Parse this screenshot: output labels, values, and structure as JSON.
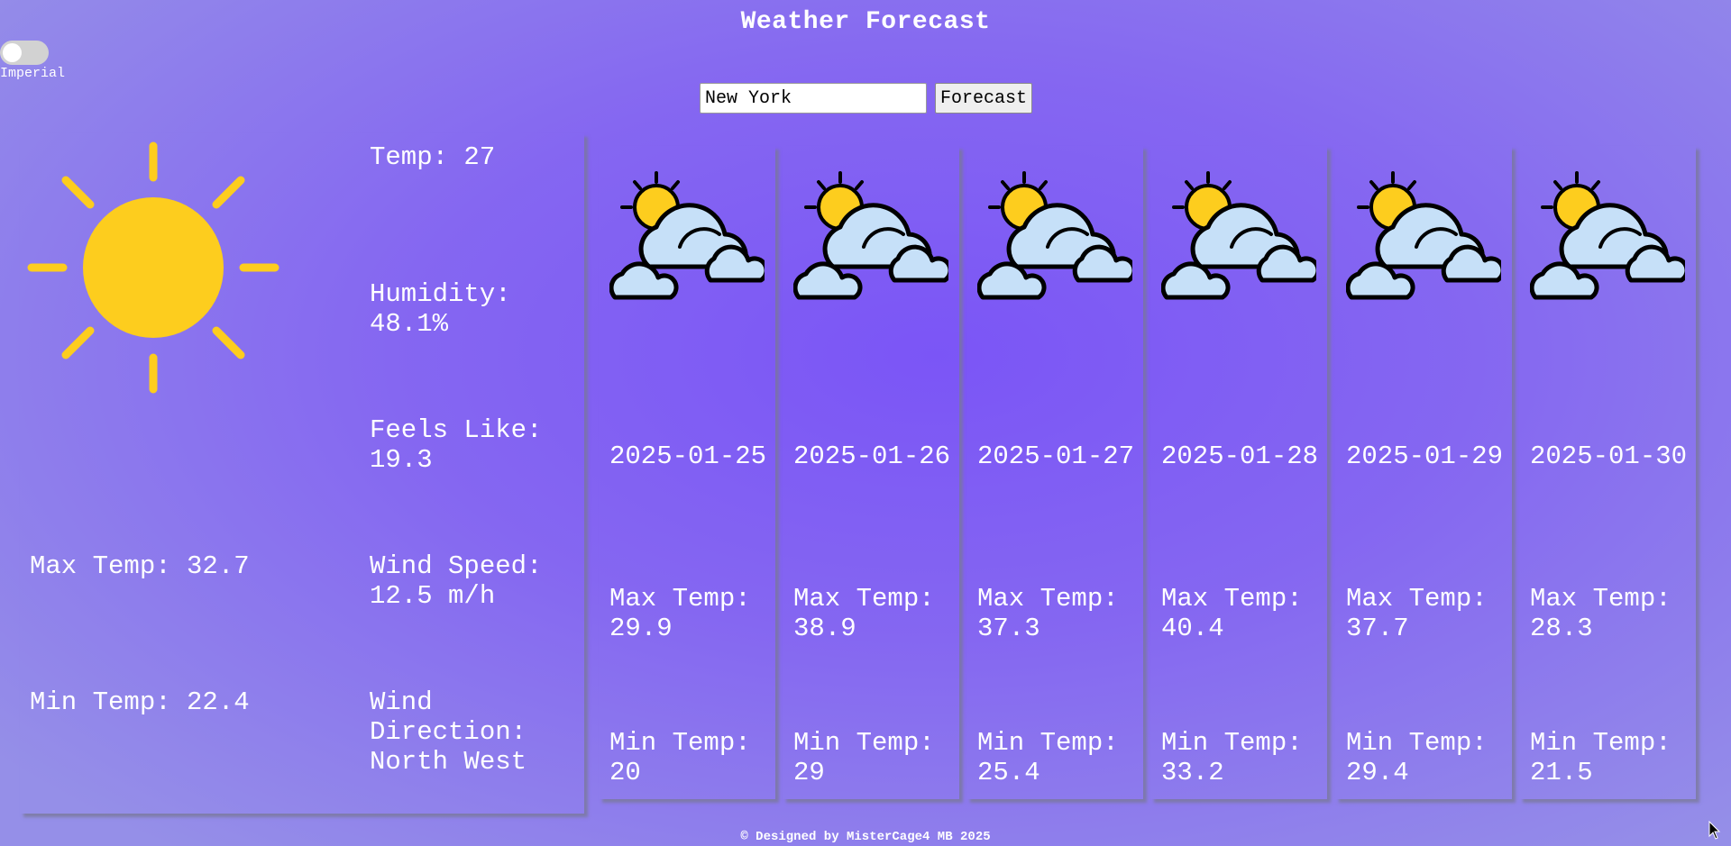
{
  "header": {
    "title": "Weather Forecast"
  },
  "units_toggle": {
    "label": "Imperial",
    "checked": false
  },
  "search": {
    "value": "New York",
    "button_label": "Forecast"
  },
  "current": {
    "icon": "sun-icon",
    "temp": "Temp: 27",
    "humidity": "Humidity: 48.1%",
    "feels_like": "Feels Like: 19.3",
    "wind_speed": "Wind Speed: 12.5 m/h",
    "wind_direction": "Wind Direction: North West",
    "max_temp": "Max Temp: 32.7",
    "min_temp": "Min Temp: 22.4"
  },
  "forecast": [
    {
      "icon": "partly-cloudy-icon",
      "date": "2025-01-25",
      "max": "Max Temp: 29.9",
      "min": "Min Temp: 20"
    },
    {
      "icon": "partly-cloudy-icon",
      "date": "2025-01-26",
      "max": "Max Temp: 38.9",
      "min": "Min Temp: 29"
    },
    {
      "icon": "partly-cloudy-icon",
      "date": "2025-01-27",
      "max": "Max Temp: 37.3",
      "min": "Min Temp: 25.4"
    },
    {
      "icon": "partly-cloudy-icon",
      "date": "2025-01-28",
      "max": "Max Temp: 40.4",
      "min": "Min Temp: 33.2"
    },
    {
      "icon": "partly-cloudy-icon",
      "date": "2025-01-29",
      "max": "Max Temp: 37.7",
      "min": "Min Temp: 29.4"
    },
    {
      "icon": "partly-cloudy-icon",
      "date": "2025-01-30",
      "max": "Max Temp: 28.3",
      "min": "Min Temp: 21.5"
    }
  ],
  "footer": {
    "text": "© Designed by MisterCage4 MB 2025"
  },
  "colors": {
    "sun": "#fdcd1e",
    "cloud": "#c6e0f8",
    "outline": "#000000",
    "accent": "#8061f3"
  }
}
